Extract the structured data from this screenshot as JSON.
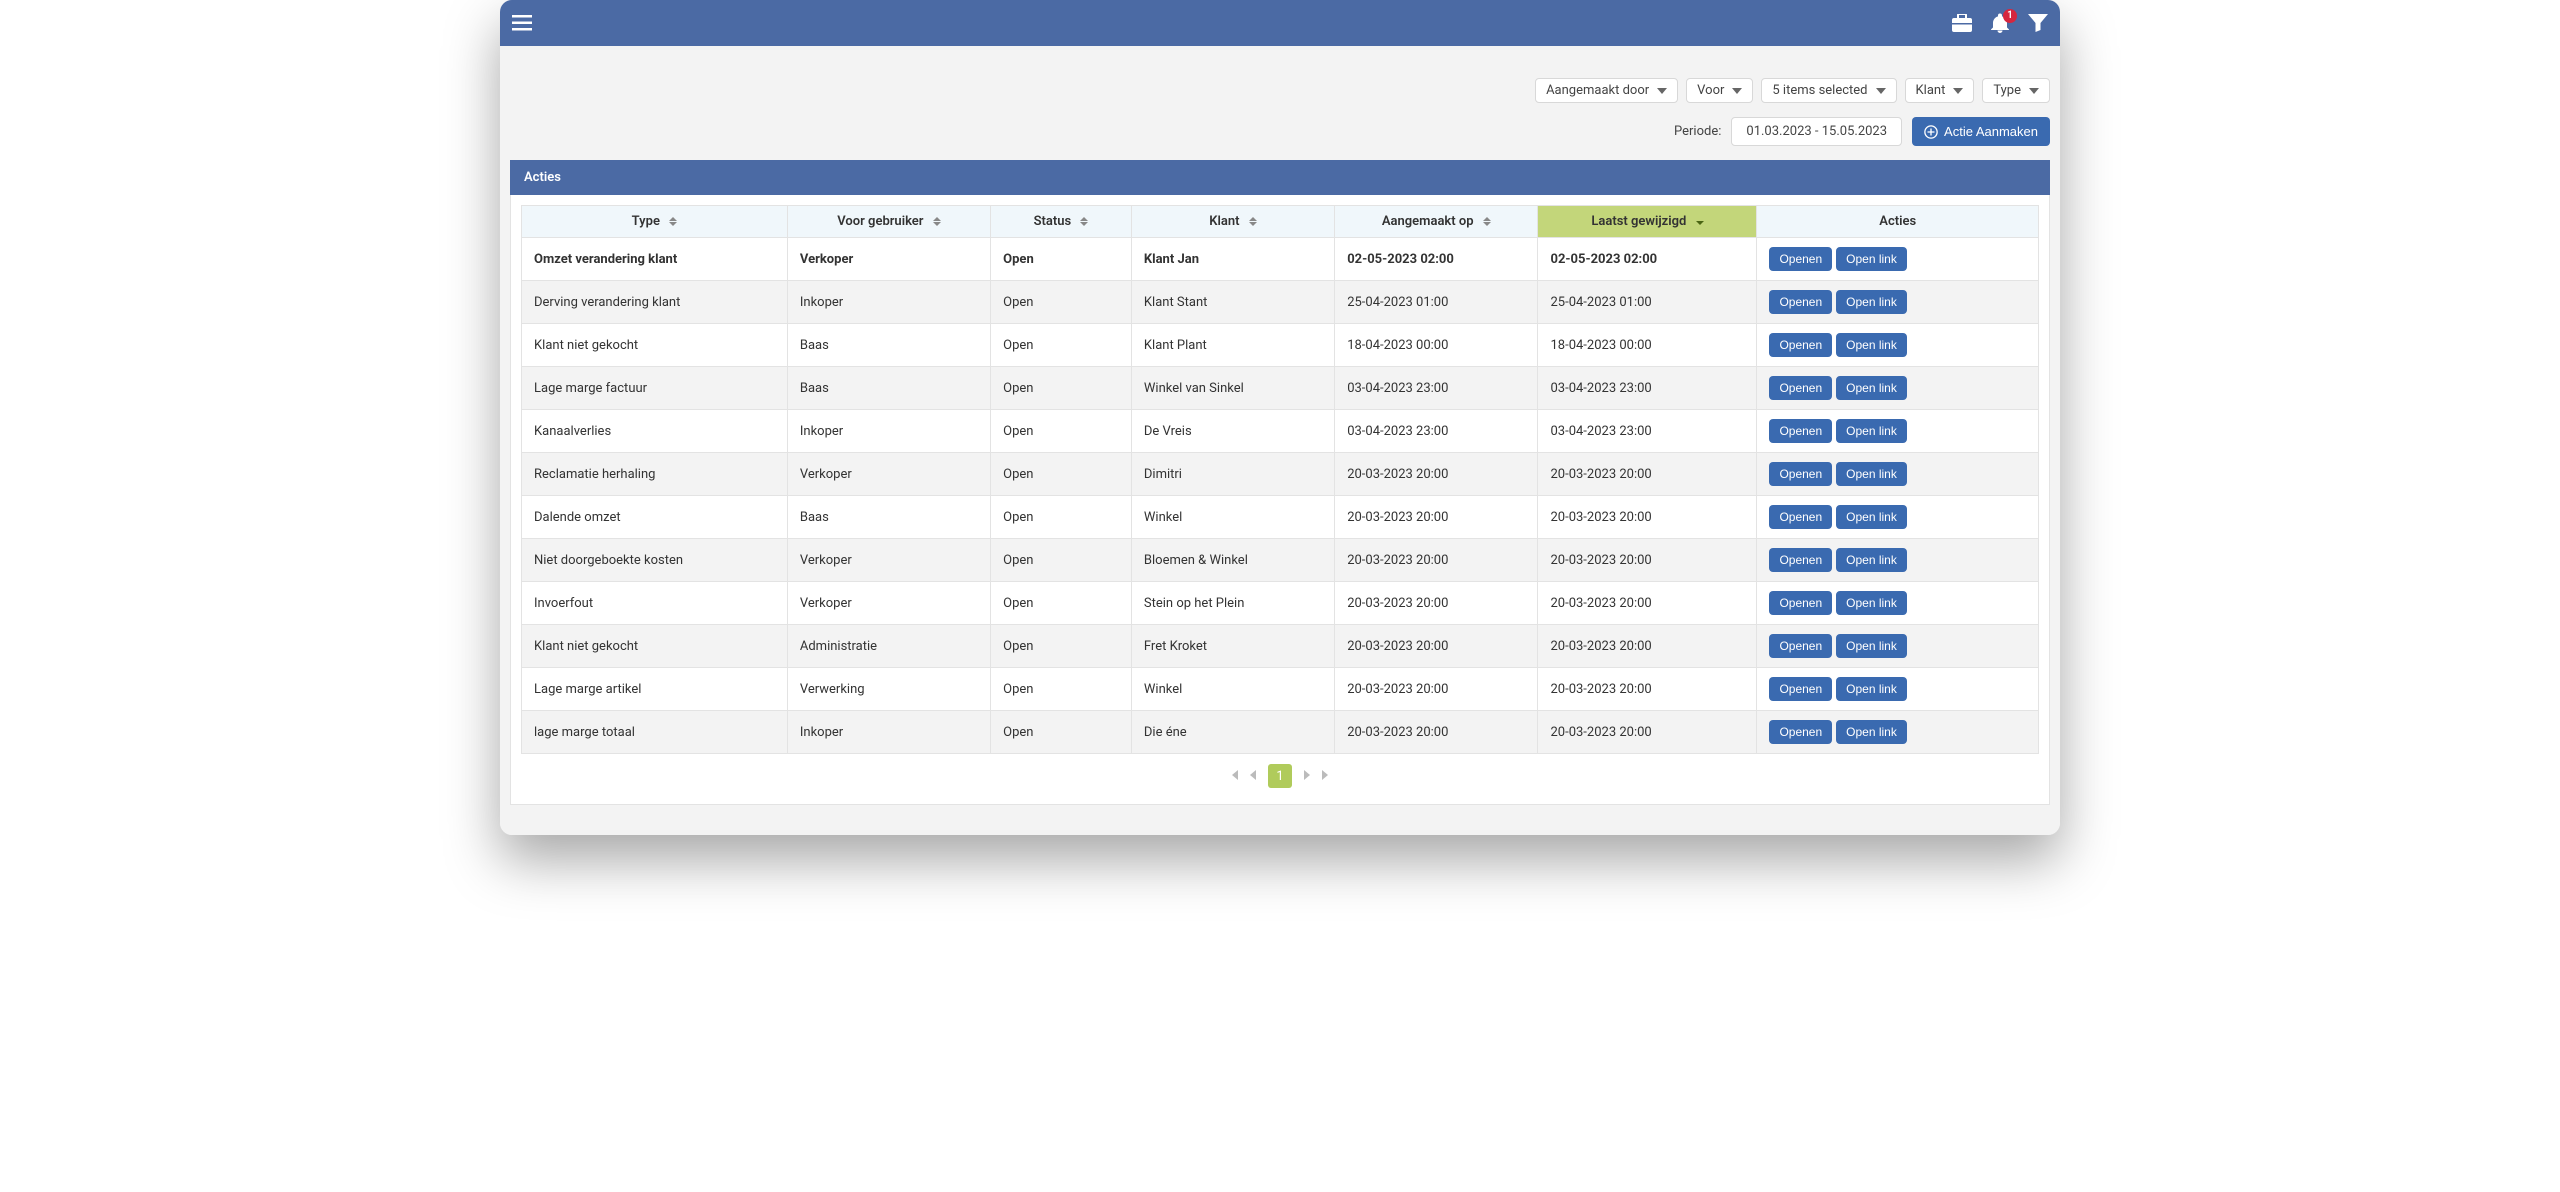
{
  "topbar": {
    "notification_count": "1"
  },
  "filters": {
    "created_by_label": "Aangemaakt door",
    "for_label": "Voor",
    "status_label": "5 items selected",
    "klant_label": "Klant",
    "type_label": "Type"
  },
  "period": {
    "label": "Periode:",
    "value": "01.03.2023 - 15.05.2023"
  },
  "create_btn_label": "Actie Aanmaken",
  "table_title": "Acties",
  "columns": {
    "type": "Type",
    "for_user": "Voor gebruiker",
    "status": "Status",
    "klant": "Klant",
    "created": "Aangemaakt op",
    "modified": "Laatst gewijzigd",
    "actions": "Acties"
  },
  "row_buttons": {
    "open": "Openen",
    "open_link": "Open link"
  },
  "pager": {
    "page": "1"
  },
  "rows": [
    {
      "type": "Omzet verandering klant",
      "user": "Verkoper",
      "status": "Open",
      "klant": "Klant Jan",
      "created": "02-05-2023 02:00",
      "modified": "02-05-2023 02:00"
    },
    {
      "type": "Derving verandering klant",
      "user": "Inkoper",
      "status": "Open",
      "klant": "Klant Stant",
      "created": "25-04-2023 01:00",
      "modified": "25-04-2023 01:00"
    },
    {
      "type": "Klant niet gekocht",
      "user": "Baas",
      "status": "Open",
      "klant": "Klant Plant",
      "created": "18-04-2023 00:00",
      "modified": "18-04-2023 00:00"
    },
    {
      "type": "Lage marge factuur",
      "user": "Baas",
      "status": "Open",
      "klant": "Winkel van Sinkel",
      "created": "03-04-2023 23:00",
      "modified": "03-04-2023 23:00"
    },
    {
      "type": "Kanaalverlies",
      "user": "Inkoper",
      "status": "Open",
      "klant": "De Vreis",
      "created": "03-04-2023 23:00",
      "modified": "03-04-2023 23:00"
    },
    {
      "type": "Reclamatie herhaling",
      "user": "Verkoper",
      "status": "Open",
      "klant": "Dimitri",
      "created": "20-03-2023 20:00",
      "modified": "20-03-2023 20:00"
    },
    {
      "type": "Dalende omzet",
      "user": "Baas",
      "status": "Open",
      "klant": "Winkel",
      "created": "20-03-2023 20:00",
      "modified": "20-03-2023 20:00"
    },
    {
      "type": "Niet doorgeboekte kosten",
      "user": "Verkoper",
      "status": "Open",
      "klant": "Bloemen & Winkel",
      "created": "20-03-2023 20:00",
      "modified": "20-03-2023 20:00"
    },
    {
      "type": "Invoerfout",
      "user": "Verkoper",
      "status": "Open",
      "klant": "Stein op het Plein",
      "created": "20-03-2023 20:00",
      "modified": "20-03-2023 20:00"
    },
    {
      "type": "Klant niet gekocht",
      "user": "Administratie",
      "status": "Open",
      "klant": "Fret Kroket",
      "created": "20-03-2023 20:00",
      "modified": "20-03-2023 20:00"
    },
    {
      "type": "Lage marge artikel",
      "user": "Verwerking",
      "status": "Open",
      "klant": "Winkel",
      "created": "20-03-2023 20:00",
      "modified": "20-03-2023 20:00"
    },
    {
      "type": "lage marge totaal",
      "user": "Inkoper",
      "status": "Open",
      "klant": "Die éne",
      "created": "20-03-2023 20:00",
      "modified": "20-03-2023 20:00"
    }
  ]
}
